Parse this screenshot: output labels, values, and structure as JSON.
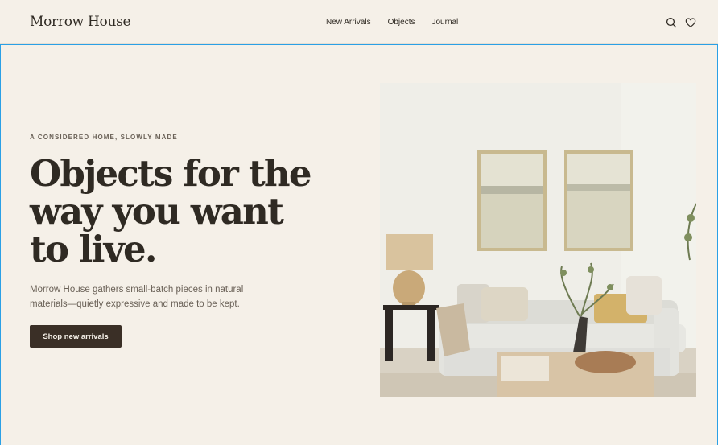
{
  "brand": {
    "name": "Morrow House"
  },
  "nav": {
    "items": [
      "New Arrivals",
      "Objects",
      "Journal"
    ]
  },
  "header_icons": {
    "search": "search-icon",
    "wishlist": "heart-icon"
  },
  "hero": {
    "eyebrow": "A CONSIDERED HOME, SLOWLY MADE",
    "headline": "Objects for the way you want to live.",
    "intro": "Morrow House gathers small-batch pieces in natural materials—quietly expressive and made to be kept.",
    "cta_label": "Shop new arrivals"
  },
  "colors": {
    "background": "#f5f0e8",
    "text": "#2f2a23",
    "muted": "#6a6157",
    "button": "#3a2f26"
  }
}
